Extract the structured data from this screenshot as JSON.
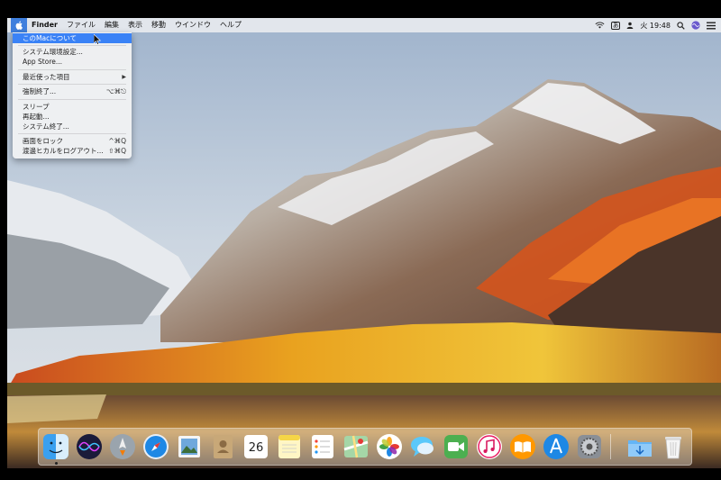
{
  "menubar": {
    "apple_icon": "apple-logo-icon",
    "app_name": "Finder",
    "menus": [
      "ファイル",
      "編集",
      "表示",
      "移動",
      "ウインドウ",
      "ヘルプ"
    ],
    "status": {
      "wifi_icon": "wifi-icon",
      "input_badge": "あ",
      "user_icon": "user-icon",
      "clock": "火 19:48",
      "search_icon": "spotlight-search-icon",
      "siri_icon": "siri-icon",
      "notification_icon": "notification-center-icon"
    }
  },
  "apple_menu": {
    "items": [
      {
        "label": "このMacについて",
        "shortcut": "",
        "selected": true
      },
      {
        "label": "システム環境設定...",
        "shortcut": ""
      },
      {
        "label": "App Store...",
        "shortcut": ""
      },
      {
        "label": "最近使った項目",
        "shortcut": "▶"
      },
      {
        "label": "強制終了...",
        "shortcut": "⌥⌘⎋"
      },
      {
        "label": "スリープ",
        "shortcut": ""
      },
      {
        "label": "再起動...",
        "shortcut": ""
      },
      {
        "label": "システム終了...",
        "shortcut": ""
      },
      {
        "label": "画面をロック",
        "shortcut": "^⌘Q"
      },
      {
        "label": "渡邊ヒカルをログアウト...",
        "shortcut": "⇧⌘Q"
      }
    ]
  },
  "dock": {
    "calendar": {
      "month": "",
      "day": "26"
    },
    "apps": [
      "finder-icon",
      "siri-icon",
      "launchpad-icon",
      "safari-icon",
      "mail-preview-icon",
      "contacts-icon",
      "calendar-icon",
      "notes-icon",
      "reminders-icon",
      "maps-icon",
      "photos-icon",
      "messages-icon",
      "facetime-icon",
      "itunes-icon",
      "ibooks-icon",
      "app-store-icon",
      "system-preferences-icon",
      "downloads-folder-icon",
      "trash-icon"
    ]
  },
  "colors": {
    "menu_highlight": "#3a82f6",
    "apple_button": "#3f7fdd"
  }
}
